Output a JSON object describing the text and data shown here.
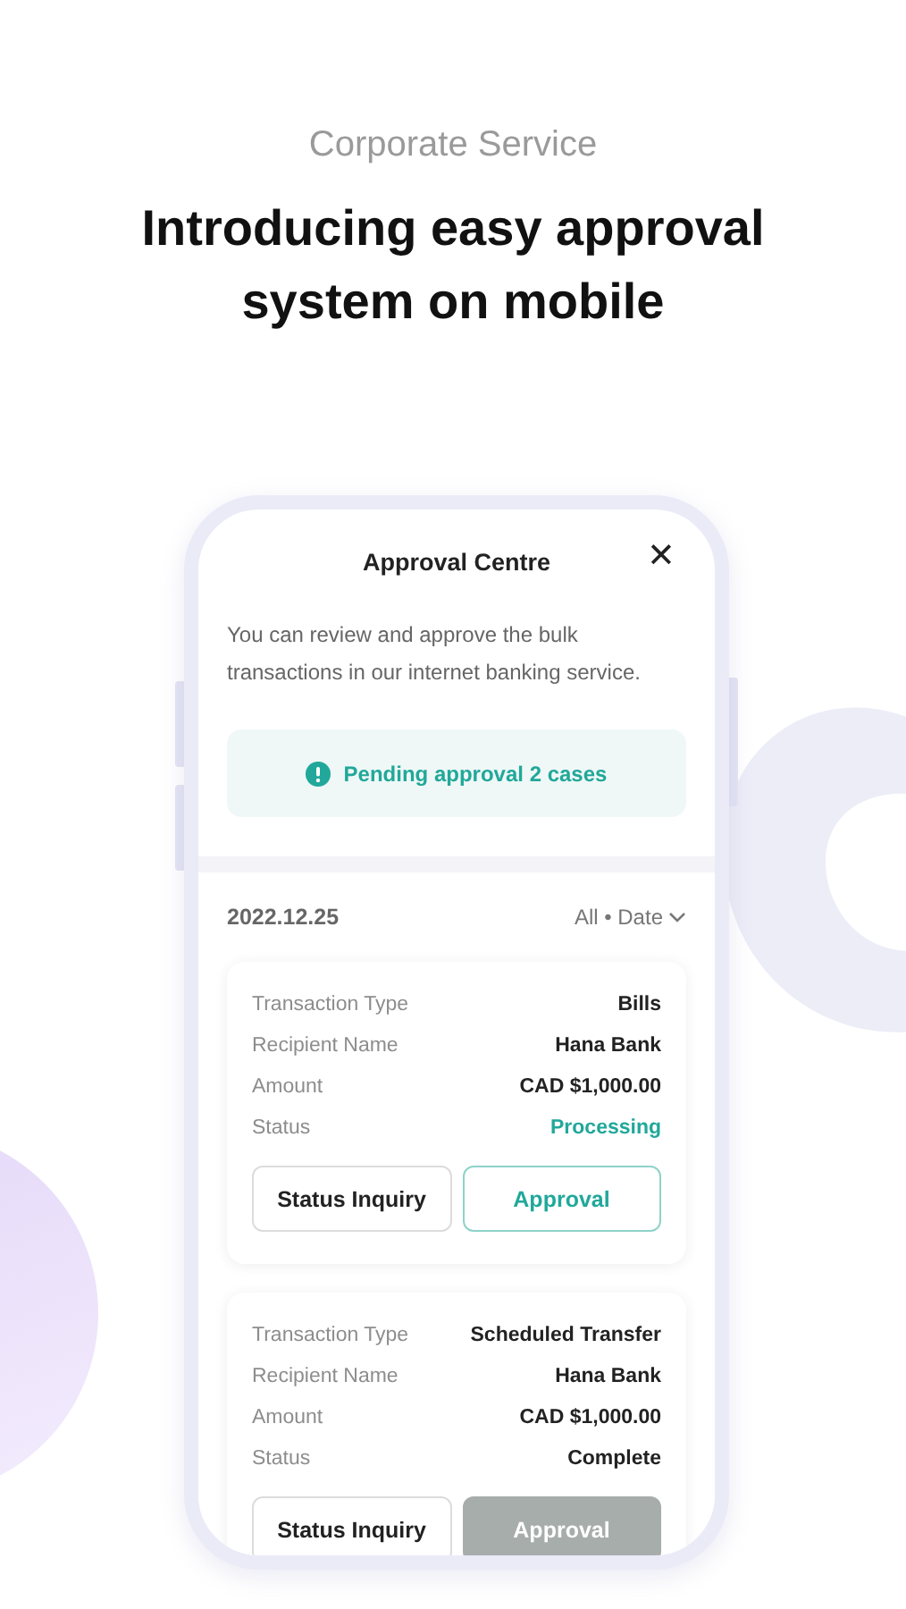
{
  "header": {
    "eyebrow": "Corporate Service",
    "title": "Introducing easy approval system on mobile"
  },
  "screen": {
    "title": "Approval Centre",
    "close": "✕",
    "description": "You can review and approve the bulk transactions in our internet banking service.",
    "notice": "Pending approval 2 cases",
    "date": "2022.12.25",
    "filter": "All • Date",
    "transactions": [
      {
        "rows": [
          {
            "label": "Transaction Type",
            "value": "Bills",
            "kind": "plain"
          },
          {
            "label": "Recipient Name",
            "value": "Hana Bank",
            "kind": "plain"
          },
          {
            "label": "Amount",
            "value": "CAD  $1,000.00",
            "kind": "plain"
          },
          {
            "label": "Status",
            "value": "Processing",
            "kind": "processing"
          }
        ],
        "inquiry": "Status Inquiry",
        "approval": "Approval",
        "disabled": false
      },
      {
        "rows": [
          {
            "label": "Transaction Type",
            "value": "Scheduled Transfer",
            "kind": "plain"
          },
          {
            "label": "Recipient Name",
            "value": "Hana Bank",
            "kind": "plain"
          },
          {
            "label": "Amount",
            "value": "CAD  $1,000.00",
            "kind": "plain"
          },
          {
            "label": "Status",
            "value": "Complete",
            "kind": "complete"
          }
        ],
        "inquiry": "Status Inquiry",
        "approval": "Approval",
        "disabled": true
      }
    ]
  }
}
